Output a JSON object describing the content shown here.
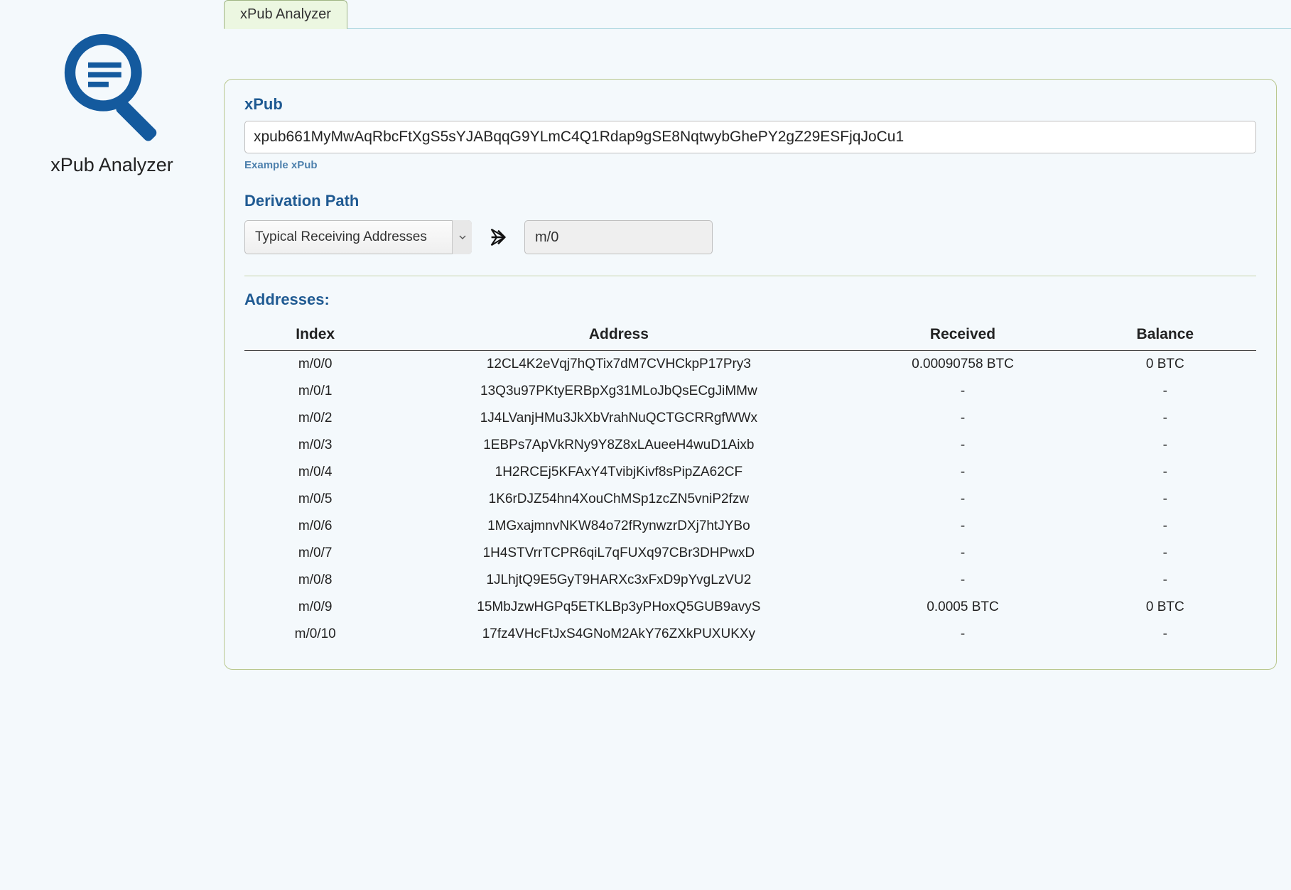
{
  "app": {
    "title": "xPub Analyzer"
  },
  "tab": {
    "label": "xPub Analyzer"
  },
  "form": {
    "xpub_label": "xPub",
    "xpub_value": "xpub661MyMwAqRbcFtXgS5sYJABqqG9YLmC4Q1Rdap9gSE8NqtwybGhePY2gZ29ESFjqJoCu1",
    "example_link": "Example xPub",
    "deriv_label": "Derivation Path",
    "deriv_select_value": "Typical Receiving Addresses",
    "deriv_path_value": "m/0"
  },
  "addresses": {
    "label": "Addresses:",
    "columns": {
      "index": "Index",
      "address": "Address",
      "received": "Received",
      "balance": "Balance"
    },
    "rows": [
      {
        "index": "m/0/0",
        "address": "12CL4K2eVqj7hQTix7dM7CVHCkpP17Pry3",
        "received": "0.00090758 BTC",
        "balance": "0 BTC"
      },
      {
        "index": "m/0/1",
        "address": "13Q3u97PKtyERBpXg31MLoJbQsECgJiMMw",
        "received": "-",
        "balance": "-"
      },
      {
        "index": "m/0/2",
        "address": "1J4LVanjHMu3JkXbVrahNuQCTGCRRgfWWx",
        "received": "-",
        "balance": "-"
      },
      {
        "index": "m/0/3",
        "address": "1EBPs7ApVkRNy9Y8Z8xLAueeH4wuD1Aixb",
        "received": "-",
        "balance": "-"
      },
      {
        "index": "m/0/4",
        "address": "1H2RCEj5KFAxY4TvibjKivf8sPipZA62CF",
        "received": "-",
        "balance": "-"
      },
      {
        "index": "m/0/5",
        "address": "1K6rDJZ54hn4XouChMSp1zcZN5vniP2fzw",
        "received": "-",
        "balance": "-"
      },
      {
        "index": "m/0/6",
        "address": "1MGxajmnvNKW84o72fRynwzrDXj7htJYBo",
        "received": "-",
        "balance": "-"
      },
      {
        "index": "m/0/7",
        "address": "1H4STVrrTCPR6qiL7qFUXq97CBr3DHPwxD",
        "received": "-",
        "balance": "-"
      },
      {
        "index": "m/0/8",
        "address": "1JLhjtQ9E5GyT9HARXc3xFxD9pYvgLzVU2",
        "received": "-",
        "balance": "-"
      },
      {
        "index": "m/0/9",
        "address": "15MbJzwHGPq5ETKLBp3yPHoxQ5GUB9avyS",
        "received": "0.0005 BTC",
        "balance": "0 BTC"
      },
      {
        "index": "m/0/10",
        "address": "17fz4VHcFtJxS4GNoM2AkY76ZXkPUXUKXy",
        "received": "-",
        "balance": "-"
      }
    ]
  }
}
